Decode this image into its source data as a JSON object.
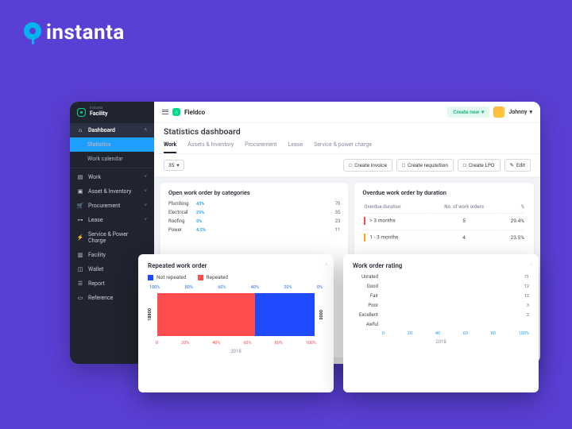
{
  "logo_text": "instanta",
  "sidebar": {
    "brand_small": "Instanta",
    "brand": "Facility",
    "dashboard": "Dashboard",
    "statistics": "Statistics",
    "work_calendar": "Work calendar",
    "work": "Work",
    "asset_inventory": "Asset & Inventory",
    "procurement": "Procurement",
    "lease": "Lease",
    "service_power": "Service & Power Charge",
    "facility": "Facility",
    "wallet": "Wallet",
    "report": "Report",
    "reference": "Reference"
  },
  "topbar": {
    "org": "Fieldco",
    "create_label": "Create new",
    "user": "Johnny"
  },
  "page_title": "Statistics dashboard",
  "tabs": {
    "work": "Work",
    "assets": "Assets & Inventory",
    "procurement": "Procurement",
    "lease": "Lease",
    "service": "Service & power charge"
  },
  "toolbar": {
    "count": "35",
    "invoice": "Create invoice",
    "requisition": "Create requisition",
    "lpo": "Create LPO",
    "edit": "Edit"
  },
  "open_work": {
    "title": "Open work order by categories",
    "rows": [
      {
        "name": "Plumbing",
        "pct": "43%",
        "w": 100,
        "val": "70"
      },
      {
        "name": "Electrical",
        "pct": "25%",
        "w": 50,
        "val": "35"
      },
      {
        "name": "Roofing",
        "pct": "5%",
        "w": 32,
        "val": "23"
      },
      {
        "name": "Power",
        "pct": "4.5%",
        "w": 14,
        "val": "11"
      }
    ]
  },
  "overdue": {
    "title": "Overdue work order by duration",
    "col1": "Overdue duration",
    "col2": "No. of work orders",
    "col3": "%",
    "rows": [
      {
        "color": "#ff4d4f",
        "dur": "> 3 months",
        "n": "5",
        "p": "29.4%"
      },
      {
        "color": "#ff9f1a",
        "dur": "1 - 3 months",
        "n": "4",
        "p": "23.5%"
      }
    ]
  },
  "repeated": {
    "title": "Repeated work order",
    "legend_not": "Not repeated",
    "legend_rep": "Repeated",
    "axis_top": [
      "100%",
      "80%",
      "60%",
      "40%",
      "20%",
      "0%"
    ],
    "y_left": "18800",
    "y_right": "5000",
    "axis_bot": [
      "0",
      "20%",
      "40%",
      "60%",
      "80%",
      "100%"
    ],
    "year": "2018",
    "red_pct": 62,
    "blue_pct": 38
  },
  "rating": {
    "title": "Work order rating",
    "rows": [
      {
        "name": "Unrated",
        "v": 71
      },
      {
        "name": "Good",
        "v": 12
      },
      {
        "name": "Fair",
        "v": 12
      },
      {
        "name": "Poor",
        "v": 3
      },
      {
        "name": "Excellent",
        "v": 2
      },
      {
        "name": "Awful",
        "v": 0
      }
    ],
    "xticks": [
      "0",
      "20",
      "40",
      "60",
      "80",
      "100%"
    ],
    "year": "2018"
  },
  "chart_data": [
    {
      "type": "bar",
      "title": "Open work order by categories",
      "categories": [
        "Plumbing",
        "Electrical",
        "Roofing",
        "Power"
      ],
      "values": [
        70,
        35,
        23,
        11
      ],
      "pct_labels": [
        "43%",
        "25%",
        "5%",
        "4.5%"
      ],
      "orientation": "horizontal"
    },
    {
      "type": "table",
      "title": "Overdue work order by duration",
      "columns": [
        "Overdue duration",
        "No. of work orders",
        "%"
      ],
      "rows": [
        [
          "> 3 months",
          5,
          "29.4%"
        ],
        [
          "1 - 3 months",
          4,
          "23.5%"
        ]
      ]
    },
    {
      "type": "bar",
      "title": "Repeated work order",
      "categories": [
        "2018"
      ],
      "series": [
        {
          "name": "Not repeated",
          "values": [
            62
          ],
          "count": 18800,
          "color": "#ff4d4f"
        },
        {
          "name": "Repeated",
          "values": [
            38
          ],
          "count": 5000,
          "color": "#1e4bff"
        }
      ],
      "stacked": true,
      "orientation": "horizontal",
      "xlabel": "%",
      "xlim": [
        0,
        100
      ]
    },
    {
      "type": "bar",
      "title": "Work order rating",
      "categories": [
        "Unrated",
        "Good",
        "Fair",
        "Poor",
        "Excellent",
        "Awful"
      ],
      "values": [
        71,
        12,
        12,
        3,
        2,
        0
      ],
      "orientation": "horizontal",
      "xlim": [
        0,
        100
      ],
      "year": 2018
    }
  ]
}
